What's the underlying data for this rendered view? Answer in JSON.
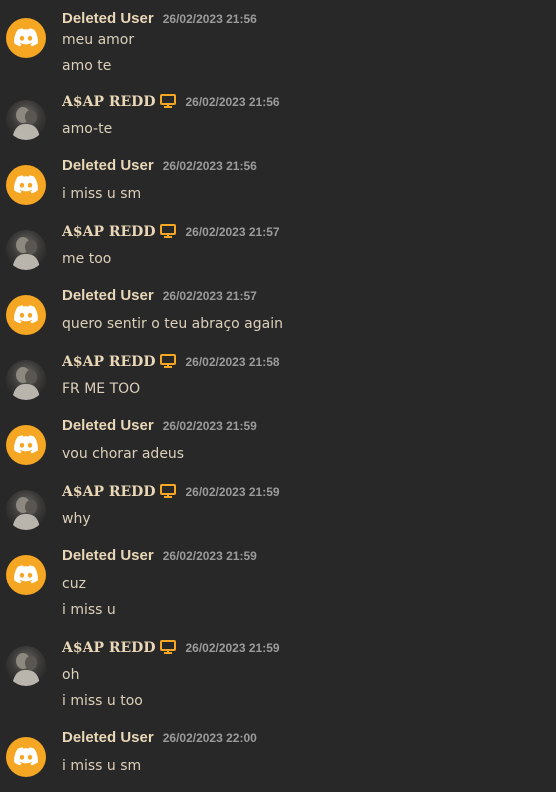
{
  "colors": {
    "background": "#282828",
    "discord_avatar": "#f5a623",
    "username": "#e9d7b7",
    "timestamp": "#9b9b9b",
    "message_text": "#dcd0ba"
  },
  "icons": {
    "discord_avatar": "discord-logo-icon",
    "desktop_badge": "monitor-icon"
  },
  "messages": [
    {
      "author": "Deleted User",
      "timestamp": "26/02/2023 21:56",
      "lines": [
        "meu amor",
        "amo te"
      ]
    },
    {
      "author": "A$AP REDD",
      "timestamp": "26/02/2023 21:56",
      "lines": [
        "amo-te"
      ]
    },
    {
      "author": "Deleted User",
      "timestamp": "26/02/2023 21:56",
      "lines": [
        "i miss u sm"
      ]
    },
    {
      "author": "A$AP REDD",
      "timestamp": "26/02/2023 21:57",
      "lines": [
        "me too"
      ]
    },
    {
      "author": "Deleted User",
      "timestamp": "26/02/2023 21:57",
      "lines": [
        "quero sentir o teu abraço again"
      ]
    },
    {
      "author": "A$AP REDD",
      "timestamp": "26/02/2023 21:58",
      "lines": [
        "FR ME TOO"
      ]
    },
    {
      "author": "Deleted User",
      "timestamp": "26/02/2023 21:59",
      "lines": [
        "vou chorar adeus"
      ]
    },
    {
      "author": "A$AP REDD",
      "timestamp": "26/02/2023 21:59",
      "lines": [
        "why"
      ]
    },
    {
      "author": "Deleted User",
      "timestamp": "26/02/2023 21:59",
      "lines": [
        "cuz",
        "i miss u"
      ]
    },
    {
      "author": "A$AP REDD",
      "timestamp": "26/02/2023 21:59",
      "lines": [
        "oh",
        "i miss u too"
      ]
    },
    {
      "author": "Deleted User",
      "timestamp": "26/02/2023 22:00",
      "lines": [
        "i miss u sm"
      ]
    }
  ]
}
